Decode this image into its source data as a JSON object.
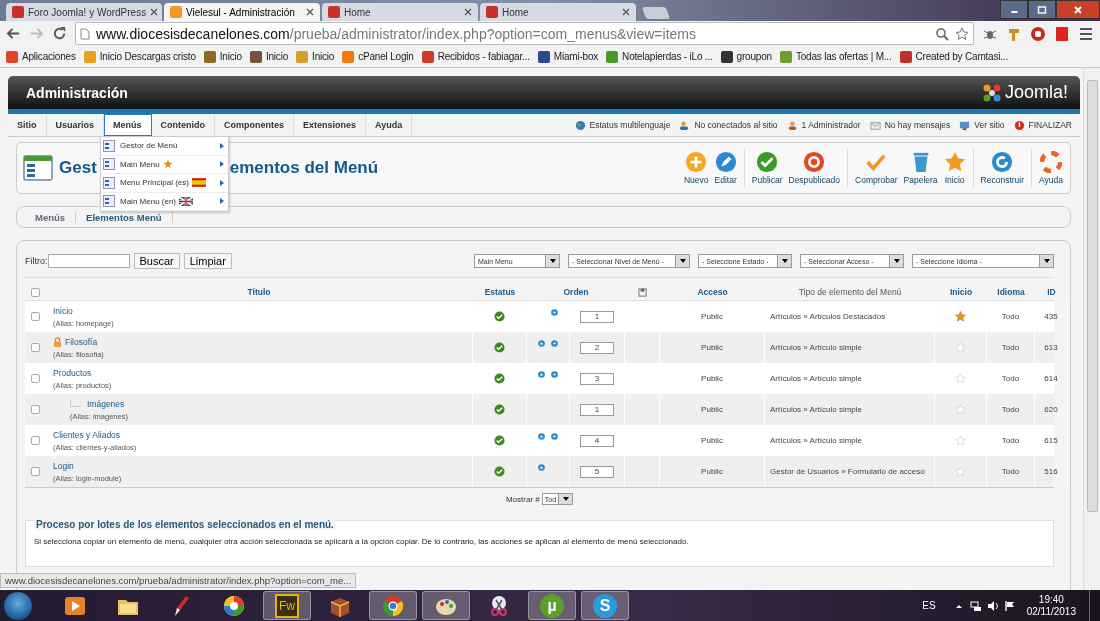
{
  "browser": {
    "tabs": [
      {
        "title": "Foro Joomla! y WordPress",
        "selected": false,
        "color": "#c8302a"
      },
      {
        "title": "Vielesul - Administración",
        "selected": true,
        "color": "#f29a1f"
      },
      {
        "title": "Home",
        "selected": false,
        "color": "#c8302a"
      },
      {
        "title": "Home",
        "selected": false,
        "color": "#c8302a"
      }
    ],
    "url": {
      "host": "www.diocesisdecanelones.com",
      "path": "/prueba/administrator/index.php?option=com_menus&view=items"
    },
    "bookmarks": [
      {
        "label": "Aplicaciones",
        "color": "#e0452b"
      },
      {
        "label": "Inicio Descargas cristo",
        "color": "#e8a020"
      },
      {
        "label": "Inicio",
        "color": "#8a6a20"
      },
      {
        "label": "Inicio",
        "color": "#7a5040"
      },
      {
        "label": "Inicio",
        "color": "#d4a030"
      },
      {
        "label": "cPanel Login",
        "color": "#f07a10"
      },
      {
        "label": "Recibidos - fabiagar...",
        "color": "#d03a2a"
      },
      {
        "label": "Miami-box",
        "color": "#2a4a8a"
      },
      {
        "label": "Notelapierdas - iLo ...",
        "color": "#4a9a2a"
      },
      {
        "label": "groupon",
        "color": "#333333"
      },
      {
        "label": "Todas las ofertas | M...",
        "color": "#6aa02a"
      },
      {
        "label": "Created by Camtasi...",
        "color": "#c0302a"
      }
    ],
    "status_url": "www.diocesisdecanelones.com/prueba/administrator/index.php?option=com_me..."
  },
  "admin": {
    "title": "Administración",
    "logo": "Joomla!",
    "menu": [
      {
        "label": "Sitio",
        "selected": false
      },
      {
        "label": "Usuarios",
        "selected": false
      },
      {
        "label": "Menús",
        "selected": true
      },
      {
        "label": "Contenido",
        "selected": false
      },
      {
        "label": "Componentes",
        "selected": false
      },
      {
        "label": "Extensiones",
        "selected": false
      },
      {
        "label": "Ayuda",
        "selected": false
      }
    ],
    "status_links": [
      {
        "label": "Estatus multilenguaje",
        "kind": "globe"
      },
      {
        "label": "No conectados al sitio",
        "kind": "users"
      },
      {
        "label": "1 Administrador",
        "kind": "user"
      },
      {
        "label": "No hay mensajes",
        "kind": "mail"
      },
      {
        "label": "Ver sitio",
        "kind": "screen"
      },
      {
        "label": "FINALIZAR",
        "kind": "power"
      }
    ],
    "menu_dropdown": [
      {
        "label": "Gestor de Menú",
        "kind": "plain"
      },
      {
        "label": "Main Menu",
        "kind": "home"
      },
      {
        "label": "Menu Principal (es)",
        "kind": "flag-es"
      },
      {
        "label": "Main Menu (en)",
        "kind": "flag-en"
      }
    ],
    "page_title_start": "Gest",
    "page_title_end": "ementos del Menú",
    "toolbar": [
      {
        "label": "Nuevo",
        "kind": "new",
        "separator_before": false
      },
      {
        "label": "Editar",
        "kind": "edit",
        "separator_before": false
      },
      {
        "label": "Publicar",
        "kind": "publish",
        "separator_before": true
      },
      {
        "label": "Despublicado",
        "kind": "unpublish",
        "separator_before": false
      },
      {
        "label": "Comprobar",
        "kind": "check",
        "separator_before": true
      },
      {
        "label": "Papelera",
        "kind": "trash",
        "separator_before": false
      },
      {
        "label": "Inicio",
        "kind": "home",
        "separator_before": false
      },
      {
        "label": "Reconstruir",
        "kind": "rebuild",
        "separator_before": true
      },
      {
        "label": "Ayuda",
        "kind": "help",
        "separator_before": true
      }
    ],
    "submenu": [
      {
        "label": "Menús",
        "selected": false
      },
      {
        "label": "Elementos Menú",
        "selected": true
      }
    ],
    "filter": {
      "label": "Filtro:",
      "buttons": [
        "Buscar",
        "Limpiar"
      ],
      "selects": [
        "Main Menu",
        "- Seleccionar Nivel de Menú -",
        "- Seleccione Estado -",
        "- Seleccionar Acceso -",
        "- Seleccione Idioma -"
      ]
    },
    "select_all": false,
    "columns": [
      "Título",
      "Estatus",
      "Orden",
      "Acceso",
      "Tipo de elemento del Menú",
      "Inicio",
      "Idioma",
      "ID"
    ],
    "rows": [
      {
        "title": "Inicio",
        "alias": "(Alias: homepage)",
        "checked": false,
        "locked": false,
        "published": true,
        "move_up": false,
        "move_down": true,
        "order": "1",
        "access": "Public",
        "type": "Artículos » Artículos Destacados",
        "home": true,
        "language": "Todo",
        "id": "435"
      },
      {
        "title": "Filosofía",
        "alias": "(Alias: filosofia)",
        "checked": false,
        "locked": true,
        "published": true,
        "move_up": true,
        "move_down": true,
        "order": "2",
        "access": "Public",
        "type": "Artículos » Artículo simple",
        "home": false,
        "language": "Todo",
        "id": "613"
      },
      {
        "title": "Productos",
        "alias": "(Alias: productos)",
        "checked": false,
        "locked": false,
        "published": true,
        "move_up": true,
        "move_down": true,
        "order": "3",
        "access": "Public",
        "type": "Artículos » Artículo simple",
        "home": false,
        "language": "Todo",
        "id": "614",
        "children": [
          {
            "title": "Imágenes",
            "alias": "(Alias: imagenes)",
            "checked": false,
            "locked": false,
            "published": true,
            "move_up": false,
            "move_down": false,
            "order": "1",
            "access": "Public",
            "type": "Artículos » Artículo simple",
            "home": false,
            "language": "Todo",
            "id": "620"
          }
        ]
      },
      {
        "title": "Clientes y Aliados",
        "alias": "(Alias: clientes-y-aliados)",
        "checked": false,
        "locked": false,
        "published": true,
        "move_up": true,
        "move_down": true,
        "order": "4",
        "access": "Public",
        "type": "Artículos » Artículo simple",
        "home": false,
        "language": "Todo",
        "id": "615"
      },
      {
        "title": "Login",
        "alias": "(Alias: login-module)",
        "checked": false,
        "locked": false,
        "published": true,
        "move_up": true,
        "move_down": false,
        "order": "5",
        "access": "Public",
        "type": "Gestor de Usuarios » Formulario de acceso",
        "home": false,
        "language": "Todo",
        "id": "516"
      }
    ],
    "pagination": {
      "label": "Mostrar #",
      "value": "Tod"
    },
    "batch": {
      "legend": "Proceso por lotes de los elementos seleccionados en el menú.",
      "text": "Si selecciona copiar un elemento de menú, cualquier otra acción seleccionada se aplicará a la opción copiar. De lo contrario, las acciones se aplican al elemento de menú seleccionado."
    }
  },
  "taskbar": {
    "apps": [
      {
        "kind": "player",
        "running": false
      },
      {
        "kind": "folder",
        "running": false
      },
      {
        "kind": "pen",
        "running": false
      },
      {
        "kind": "pinwheel",
        "running": false
      },
      {
        "kind": "text-square",
        "text": "Fw",
        "running": true
      },
      {
        "kind": "box",
        "running": false
      },
      {
        "kind": "chrome",
        "running": true
      },
      {
        "kind": "palette",
        "running": true
      },
      {
        "kind": "scissors",
        "running": false
      },
      {
        "kind": "text-circle-green",
        "text": "µ",
        "running": true
      },
      {
        "kind": "text-circle-blue",
        "text": "S",
        "running": true
      }
    ],
    "language": "ES",
    "time": "19:40",
    "date": "02/11/2013"
  }
}
